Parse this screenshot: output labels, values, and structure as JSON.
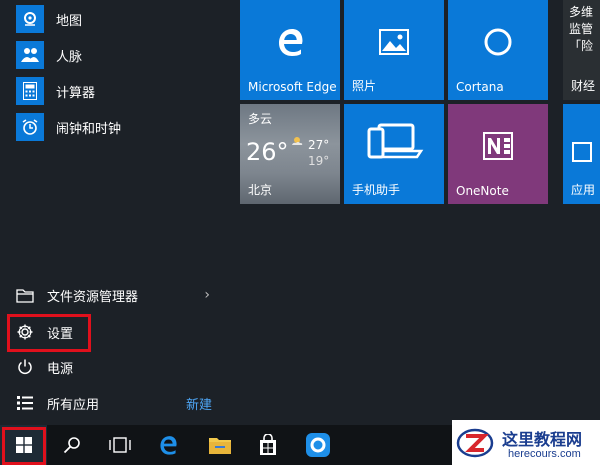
{
  "apps": [
    {
      "label": "地图",
      "icon": "map-pin-icon"
    },
    {
      "label": "人脉",
      "icon": "people-icon"
    },
    {
      "label": "计算器",
      "icon": "calculator-icon"
    },
    {
      "label": "闹钟和时钟",
      "icon": "alarm-clock-icon"
    }
  ],
  "system": {
    "file_explorer": "文件资源管理器",
    "settings": "设置",
    "power": "电源",
    "all_apps": "所有应用",
    "new_badge": "新建"
  },
  "tiles": {
    "edge": "Microsoft Edge",
    "photos": "照片",
    "cortana": "Cortana",
    "finance_label": "财经",
    "finance_headline_1": "多维",
    "finance_headline_2": "监管",
    "finance_headline_3": "「险",
    "weather_cond": "多云",
    "weather_temp": "26°",
    "weather_hi": "27°",
    "weather_lo": "19°",
    "weather_city": "北京",
    "phone": "手机助手",
    "onenote": "OneNote",
    "store": "应用"
  },
  "colors": {
    "tile_blue": "#0a79d8",
    "onenote_purple": "#80397b",
    "highlight_red": "#e0101c",
    "new_blue": "#4ea6f5"
  },
  "watermark": {
    "title": "这里教程网",
    "url": "herecours.com"
  }
}
